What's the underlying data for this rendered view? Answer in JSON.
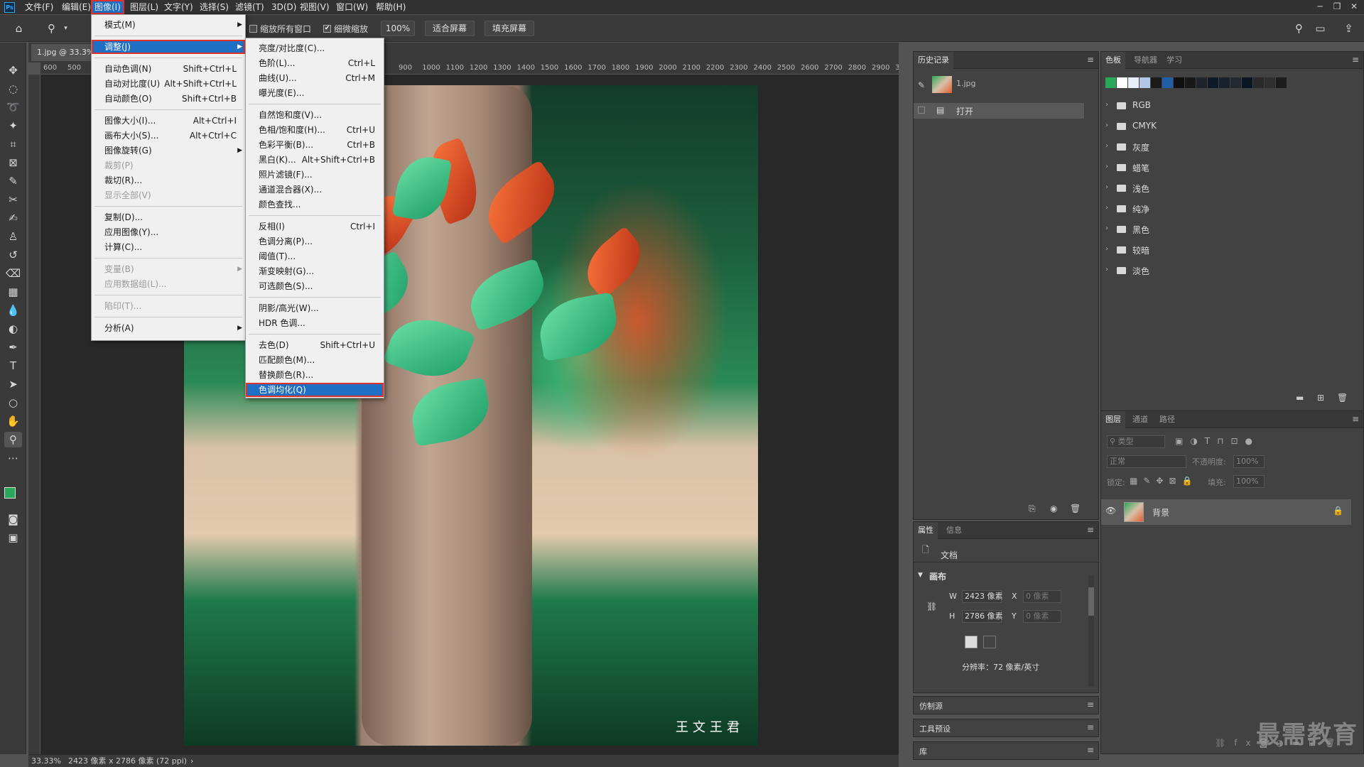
{
  "app": {
    "logo": "Ps"
  },
  "menubar": {
    "items": [
      "文件(F)",
      "编辑(E)",
      "图像(I)",
      "图层(L)",
      "文字(Y)",
      "选择(S)",
      "滤镜(T)",
      "3D(D)",
      "视图(V)",
      "窗口(W)",
      "帮助(H)"
    ],
    "active": "图像(I)"
  },
  "options": {
    "zoom_all_label": "缩放所有窗口",
    "scrubby_label": "细微缩放",
    "scrubby_checked": "✔",
    "zoom_value": "100%",
    "fit_screen": "适合屏幕",
    "fill_screen": "填充屏幕"
  },
  "document": {
    "tab_title": "1.jpg @ 33.3%",
    "ruler_ticks": [
      "600",
      "500",
      "900",
      "1000",
      "1100",
      "1200",
      "1300",
      "1400",
      "1500",
      "1600",
      "1700",
      "1800",
      "1900",
      "2000",
      "2100",
      "2200",
      "2300",
      "2400",
      "2500",
      "2600",
      "2700",
      "2800",
      "2900",
      "3"
    ],
    "watermark": "王文王君"
  },
  "image_menu": {
    "items": [
      {
        "label": "模式(M)",
        "shortcut": "",
        "submenu": true,
        "disabled": false
      },
      {
        "sep": true
      },
      {
        "label": "调整(J)",
        "shortcut": "",
        "submenu": true,
        "disabled": false,
        "highlight": true
      },
      {
        "sep": true
      },
      {
        "label": "自动色调(N)",
        "shortcut": "Shift+Ctrl+L"
      },
      {
        "label": "自动对比度(U)",
        "shortcut": "Alt+Shift+Ctrl+L"
      },
      {
        "label": "自动颜色(O)",
        "shortcut": "Shift+Ctrl+B"
      },
      {
        "sep": true
      },
      {
        "label": "图像大小(I)...",
        "shortcut": "Alt+Ctrl+I"
      },
      {
        "label": "画布大小(S)...",
        "shortcut": "Alt+Ctrl+C"
      },
      {
        "label": "图像旋转(G)",
        "shortcut": "",
        "submenu": true
      },
      {
        "label": "裁剪(P)",
        "shortcut": "",
        "disabled": true
      },
      {
        "label": "裁切(R)...",
        "shortcut": ""
      },
      {
        "label": "显示全部(V)",
        "shortcut": "",
        "disabled": true
      },
      {
        "sep": true
      },
      {
        "label": "复制(D)...",
        "shortcut": ""
      },
      {
        "label": "应用图像(Y)...",
        "shortcut": ""
      },
      {
        "label": "计算(C)...",
        "shortcut": ""
      },
      {
        "sep": true
      },
      {
        "label": "变量(B)",
        "shortcut": "",
        "submenu": true,
        "disabled": true
      },
      {
        "label": "应用数据组(L)...",
        "shortcut": "",
        "disabled": true
      },
      {
        "sep": true
      },
      {
        "label": "陷印(T)...",
        "shortcut": "",
        "disabled": true
      },
      {
        "sep": true
      },
      {
        "label": "分析(A)",
        "shortcut": "",
        "submenu": true
      }
    ]
  },
  "adjust_menu": {
    "items": [
      {
        "label": "亮度/对比度(C)...",
        "shortcut": ""
      },
      {
        "label": "色阶(L)...",
        "shortcut": "Ctrl+L"
      },
      {
        "label": "曲线(U)...",
        "shortcut": "Ctrl+M"
      },
      {
        "label": "曝光度(E)...",
        "shortcut": ""
      },
      {
        "sep": true
      },
      {
        "label": "自然饱和度(V)...",
        "shortcut": ""
      },
      {
        "label": "色相/饱和度(H)...",
        "shortcut": "Ctrl+U"
      },
      {
        "label": "色彩平衡(B)...",
        "shortcut": "Ctrl+B"
      },
      {
        "label": "黑白(K)...",
        "shortcut": "Alt+Shift+Ctrl+B"
      },
      {
        "label": "照片滤镜(F)...",
        "shortcut": ""
      },
      {
        "label": "通道混合器(X)...",
        "shortcut": ""
      },
      {
        "label": "颜色查找...",
        "shortcut": ""
      },
      {
        "sep": true
      },
      {
        "label": "反相(I)",
        "shortcut": "Ctrl+I"
      },
      {
        "label": "色调分离(P)...",
        "shortcut": ""
      },
      {
        "label": "阈值(T)...",
        "shortcut": ""
      },
      {
        "label": "渐变映射(G)...",
        "shortcut": ""
      },
      {
        "label": "可选颜色(S)...",
        "shortcut": ""
      },
      {
        "sep": true
      },
      {
        "label": "阴影/高光(W)...",
        "shortcut": ""
      },
      {
        "label": "HDR 色调...",
        "shortcut": ""
      },
      {
        "sep": true
      },
      {
        "label": "去色(D)",
        "shortcut": "Shift+Ctrl+U"
      },
      {
        "label": "匹配颜色(M)...",
        "shortcut": ""
      },
      {
        "label": "替换颜色(R)...",
        "shortcut": ""
      },
      {
        "label": "色调均化(Q)",
        "shortcut": "",
        "highlight": true
      }
    ]
  },
  "history": {
    "tab": "历史记录",
    "snapshot": "1.jpg",
    "steps": [
      "打开"
    ]
  },
  "swatches": {
    "tabs": [
      "色板",
      "导航器",
      "学习"
    ],
    "colors": [
      "#2aa85a",
      "#ffffff",
      "#e8eef8",
      "#b4c6e8",
      "#1a1a1a",
      "#1f5fa8",
      "#101010",
      "#181818",
      "#20242a",
      "#0e1a26",
      "#18222c",
      "#222a30",
      "#0a1622",
      "#2a2a2a",
      "#303030",
      "#1c1c1c"
    ],
    "groups": [
      "RGB",
      "CMYK",
      "灰度",
      "蜡笔",
      "浅色",
      "纯净",
      "黑色",
      "较暗",
      "淡色"
    ]
  },
  "properties": {
    "tabs": [
      "属性",
      "信息"
    ],
    "doc_label": "文档",
    "canvas_label": "画布",
    "w_label": "W",
    "h_label": "H",
    "x_label": "X",
    "y_label": "Y",
    "w_value": "2423 像素",
    "h_value": "2786 像素",
    "x_value": "0 像素",
    "y_value": "0 像素",
    "resolution": "分辨率：72 像素/英寸"
  },
  "collapsed_panels": [
    "仿制源",
    "工具预设",
    "库"
  ],
  "layers": {
    "tabs": [
      "图层",
      "通道",
      "路径"
    ],
    "filter_placeholder": "类型",
    "blend_mode": "正常",
    "opacity_label": "不透明度:",
    "opacity_value": "100%",
    "lock_label": "锁定:",
    "fill_label": "填充:",
    "fill_value": "100%",
    "layer_name": "背景"
  },
  "status": {
    "zoom": "33.33%",
    "info": "2423 像素 x 2786 像素 (72 ppi)"
  },
  "brand_watermark": "最需教育"
}
